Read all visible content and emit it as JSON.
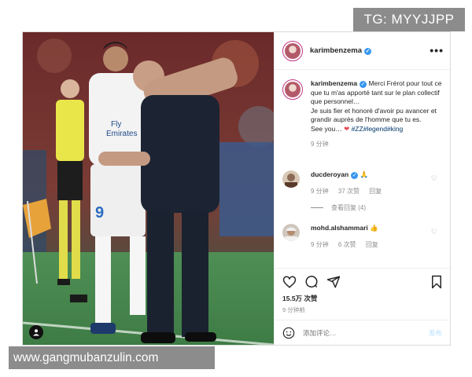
{
  "watermarks": {
    "top": "TG: MYYJJPP",
    "bottom": "www.gangmubanzulin.com"
  },
  "post": {
    "username": "karimbenzema",
    "verified_mark": "✓",
    "more_icon": "•••",
    "caption": {
      "username": "karimbenzema",
      "line1": "Merci Frérot pour tout ce que tu m'as apporté tant sur le plan collectif que personnel…",
      "line2": "Je suis fier et honoré d'avoir pu avancer et grandir auprès de l'homme que tu es.",
      "line3_text": "See you…",
      "heart": "❤",
      "hashtags": [
        "#ZZ",
        "#legend",
        "#king"
      ],
      "time": "9 分钟"
    },
    "comments": [
      {
        "username": "ducderoyan",
        "emoji": "🙏",
        "time": "9 分钟",
        "likes": "37 次赞",
        "reply": "回复",
        "view_replies": "查看回复 (4)"
      },
      {
        "username": "mohd.alshammari",
        "emoji": "👍",
        "time": "9 分钟",
        "likes": "6 次赞",
        "reply": "回复"
      }
    ],
    "likes_count": "15.5万 次赞",
    "posted_time": "9 分钟前",
    "add_comment_placeholder": "添加评论…",
    "post_button": "发布"
  },
  "colors": {
    "accent_link": "#00376b",
    "verified": "#3897f0",
    "heart": "#ed4956",
    "muted": "#8e8e8e",
    "post_btn_disabled": "#b2dffc"
  },
  "icons": [
    "heart-icon",
    "comment-icon",
    "share-icon",
    "bookmark-icon",
    "emoji-icon",
    "more-icon",
    "user-tag-icon"
  ]
}
